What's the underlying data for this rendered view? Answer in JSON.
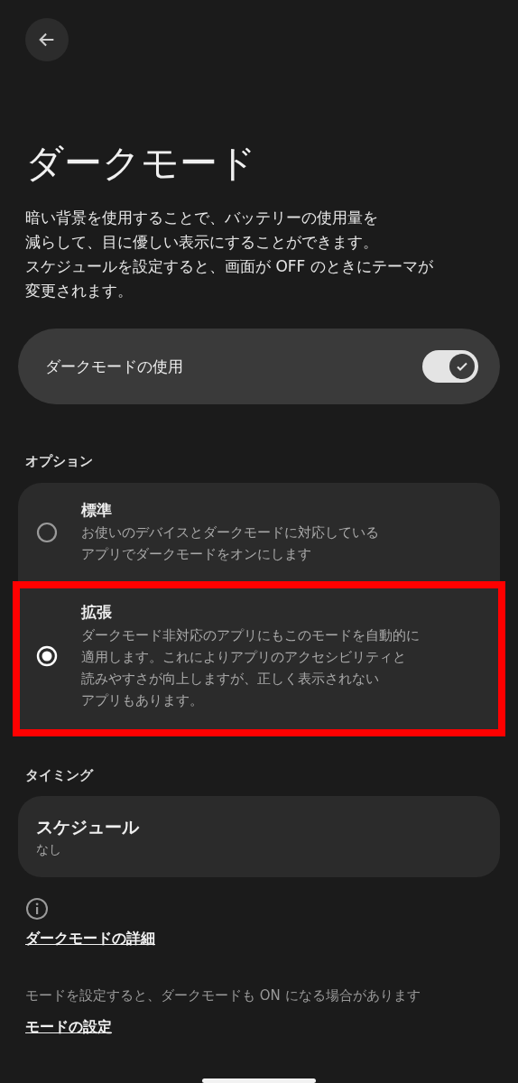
{
  "title": "ダークモード",
  "description": [
    "暗い背景を使用することで、バッテリーの使用量を",
    "減らして、目に優しい表示にすることができます。",
    "スケジュールを設定すると、画面が OFF のときにテーマが",
    "変更されます。"
  ],
  "main_toggle": {
    "label": "ダークモードの使用",
    "on": true
  },
  "options_section": {
    "heading": "オプション",
    "options": [
      {
        "title": "標準",
        "description": [
          "お使いのデバイスとダークモードに対応している",
          "アプリでダークモードをオンにします"
        ],
        "selected": false,
        "highlighted": false
      },
      {
        "title": "拡張",
        "description": [
          "ダークモード非対応のアプリにもこのモードを自動的に",
          "適用します。これによりアプリのアクセシビリティと",
          "読みやすさが向上しますが、正しく表示されない",
          "アプリもあります。"
        ],
        "selected": true,
        "highlighted": true
      }
    ]
  },
  "timing_section": {
    "heading": "タイミング",
    "schedule": {
      "title": "スケジュール",
      "value": "なし"
    }
  },
  "footer": {
    "link_1": "ダークモードの詳細",
    "note": "モードを設定すると、ダークモードも ON になる場合があります",
    "link_2": "モードの設定"
  }
}
